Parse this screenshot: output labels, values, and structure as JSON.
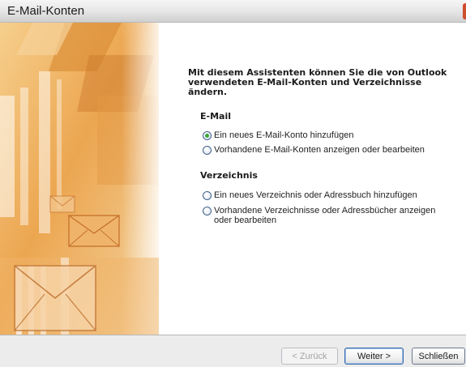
{
  "window": {
    "title": "E-Mail-Konten"
  },
  "wizard": {
    "intro_line1": "Mit diesem Assistenten können Sie die von Outlook",
    "intro_line2": "verwendeten E-Mail-Konten und Verzeichnisse ändern.",
    "email_section": {
      "heading": "E-Mail",
      "options": [
        {
          "label": "Ein neues E-Mail-Konto hinzufügen",
          "selected": true
        },
        {
          "label": "Vorhandene E-Mail-Konten anzeigen oder bearbeiten",
          "selected": false
        }
      ]
    },
    "directory_section": {
      "heading": "Verzeichnis",
      "options": [
        {
          "label": "Ein neues Verzeichnis oder Adressbuch hinzufügen",
          "selected": false
        },
        {
          "label_line1": "Vorhandene Verzeichnisse oder Adressbücher anzeigen",
          "label_line2": "oder bearbeiten",
          "selected": false
        }
      ]
    }
  },
  "buttons": {
    "back": "< Zurück",
    "next": "Weiter >",
    "close": "Schließen"
  },
  "colors": {
    "accent_orange": "#e9a14a",
    "radio_checked": "#3aa63a",
    "close_button": "#cf4d2f"
  }
}
